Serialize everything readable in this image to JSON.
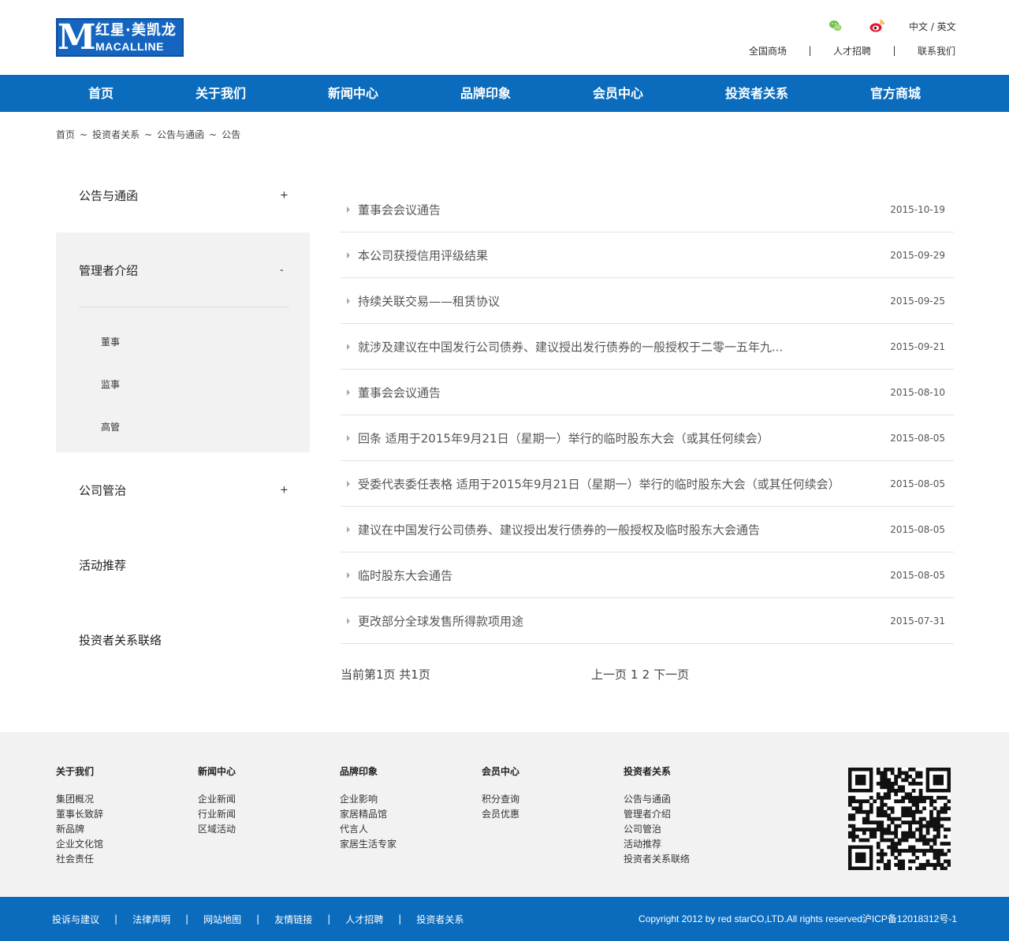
{
  "header": {
    "logo": {
      "letter": "M",
      "cn": "红星·美凯龙",
      "en": "MACALLINE"
    },
    "icons": [
      "wechat-icon",
      "weibo-icon"
    ],
    "lang": "中文 / 英文",
    "links": [
      "全国商场",
      "人才招聘",
      "联系我们"
    ],
    "link_separator": "|"
  },
  "nav": [
    "首页",
    "关于我们",
    "新闻中心",
    "品牌印象",
    "会员中心",
    "投资者关系",
    "官方商城"
  ],
  "breadcrumb": [
    "首页",
    "~",
    "投资者关系",
    "~",
    "公告与通函",
    "~",
    "公告"
  ],
  "sidebar": {
    "items": [
      {
        "label": "公告与通函",
        "sign": "+"
      },
      {
        "label": "管理者介绍",
        "sign": "-"
      },
      {
        "label": "公司管治",
        "sign": "+"
      },
      {
        "label": "活动推荐",
        "sign": ""
      },
      {
        "label": "投资者关系联络",
        "sign": ""
      }
    ],
    "sub_items": [
      "董事",
      "监事",
      "高管"
    ]
  },
  "list": [
    {
      "title": "董事会会议通告",
      "date": "2015-10-19"
    },
    {
      "title": "本公司获授信用评级结果",
      "date": "2015-09-29"
    },
    {
      "title": "持续关联交易——租赁协议",
      "date": "2015-09-25"
    },
    {
      "title": "就涉及建议在中国发行公司债券、建议授出发行债券的一般授权于二零一五年九...",
      "date": "2015-09-21"
    },
    {
      "title": "董事会会议通告",
      "date": "2015-08-10"
    },
    {
      "title": "回条 适用于2015年9月21日（星期一）举行的临时股东大会（或其任何续会）",
      "date": "2015-08-05"
    },
    {
      "title": "受委代表委任表格 适用于2015年9月21日（星期一）举行的临时股东大会（或其任何续会）",
      "date": "2015-08-05"
    },
    {
      "title": "建议在中国发行公司债券、建议授出发行债券的一般授权及临时股东大会通告",
      "date": "2015-08-05"
    },
    {
      "title": "临时股东大会通告",
      "date": "2015-08-05"
    },
    {
      "title": "更改部分全球发售所得款项用途",
      "date": "2015-07-31"
    }
  ],
  "pagination": {
    "info": "当前第1页 共1页",
    "prev": "上一页",
    "pages": [
      "1",
      "2"
    ],
    "next": "下一页"
  },
  "footer": {
    "columns": [
      {
        "heading": "关于我们",
        "links": [
          "集团概况",
          "董事长致辞",
          "新品牌",
          "企业文化馆",
          "社会责任"
        ]
      },
      {
        "heading": "新闻中心",
        "links": [
          "企业新闻",
          "行业新闻",
          "区域活动"
        ]
      },
      {
        "heading": "品牌印象",
        "links": [
          "企业影响",
          "家居精品馆",
          "代言人",
          "家居生活专家"
        ]
      },
      {
        "heading": "会员中心",
        "links": [
          "积分查询",
          "会员优惠"
        ]
      },
      {
        "heading": "投资者关系",
        "links": [
          "公告与通函",
          "管理者介绍",
          "公司管治",
          "活动推荐",
          "投资者关系联络"
        ]
      }
    ],
    "qr": "qr-code"
  },
  "bottom": {
    "links": [
      "投诉与建议",
      "法律声明",
      "网站地图",
      "友情链接",
      "人才招聘",
      "投资者关系"
    ],
    "separator": "|",
    "copyright": "Copyright 2012 by red starCO,LTD.All rights reserved沪ICP备12018312号-1"
  },
  "colors": {
    "brand_blue": "#0b6cbe",
    "footer_bg": "#f2f2f2",
    "sidebar_active_bg": "#f2f2f2"
  }
}
